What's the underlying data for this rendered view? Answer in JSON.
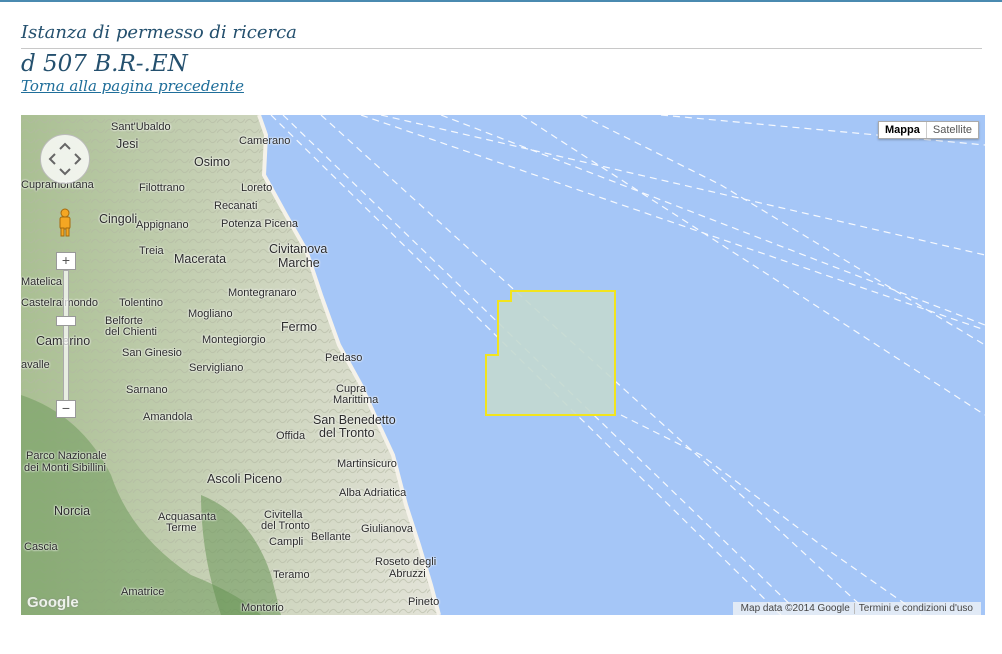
{
  "page": {
    "subtitle": "Istanza di permesso di ricerca",
    "title": "d 507 B.R-.EN",
    "back_link": "Torna alla pagina precedente"
  },
  "map": {
    "map_types": [
      "Mappa",
      "Satellite"
    ],
    "selected_map_type": "Mappa",
    "attribution": "Map data ©2014 Google",
    "terms": "Termini e condizioni d'uso",
    "logo": "Google",
    "zoom_in": "+",
    "zoom_out": "−",
    "colors": {
      "sea": "#a5c6f7",
      "permit_outline": "#f2e41d",
      "permit_fill": "#c3d8cf",
      "land": "#cfd6c3"
    },
    "icons": [
      "pan-control-icon",
      "pegman-icon"
    ],
    "places": [
      {
        "name": "Sant'Ubaldo"
      },
      {
        "name": "Camerano"
      },
      {
        "name": "Jesi"
      },
      {
        "name": "Osimo"
      },
      {
        "name": "Cupramontana"
      },
      {
        "name": "Filottrano"
      },
      {
        "name": "Loreto"
      },
      {
        "name": "Recanati"
      },
      {
        "name": "Cingoli"
      },
      {
        "name": "Appignano"
      },
      {
        "name": "Potenza Picena"
      },
      {
        "name": "Civitanova"
      },
      {
        "name": "Marche"
      },
      {
        "name": "Treia"
      },
      {
        "name": "Macerata"
      },
      {
        "name": "Matelica"
      },
      {
        "name": "Montegranaro"
      },
      {
        "name": "Castelraimondo"
      },
      {
        "name": "Tolentino"
      },
      {
        "name": "Mogliano"
      },
      {
        "name": "Fermo"
      },
      {
        "name": "Belforte"
      },
      {
        "name": "del Chienti"
      },
      {
        "name": "Montegiorgio"
      },
      {
        "name": "Camerino"
      },
      {
        "name": "San Ginesio"
      },
      {
        "name": "Pedaso"
      },
      {
        "name": "Servigliano"
      },
      {
        "name": "avalle"
      },
      {
        "name": "Sarnano"
      },
      {
        "name": "Cupra"
      },
      {
        "name": "Marittima"
      },
      {
        "name": "Amandola"
      },
      {
        "name": "San Benedetto"
      },
      {
        "name": "del Tronto"
      },
      {
        "name": "Offida"
      },
      {
        "name": "Parco Nazionale"
      },
      {
        "name": "dei Monti Sibillini"
      },
      {
        "name": "Martinsicuro"
      },
      {
        "name": "Ascoli Piceno"
      },
      {
        "name": "Alba Adriatica"
      },
      {
        "name": "Norcia"
      },
      {
        "name": "Acquasanta"
      },
      {
        "name": "Terme"
      },
      {
        "name": "Civitella"
      },
      {
        "name": "del Tronto"
      },
      {
        "name": "Campli"
      },
      {
        "name": "Bellante"
      },
      {
        "name": "Giulianova"
      },
      {
        "name": "Cascia"
      },
      {
        "name": "Teramo"
      },
      {
        "name": "Roseto degli"
      },
      {
        "name": "Abruzzi"
      },
      {
        "name": "Amatrice"
      },
      {
        "name": "Montorio"
      },
      {
        "name": "Pineto"
      }
    ]
  }
}
